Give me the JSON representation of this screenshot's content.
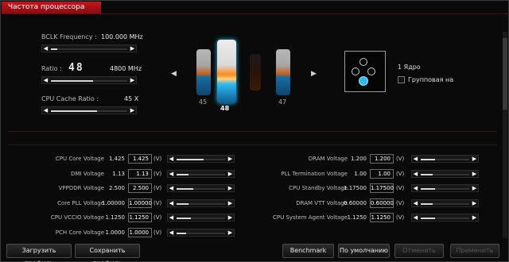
{
  "tab": {
    "title": "Частота процессора"
  },
  "bclk": {
    "label": "BCLK Frequency :",
    "value": "100.000 MHz",
    "slider_fraction": 0.08
  },
  "ratio": {
    "label": "Ratio :",
    "big_value": "48",
    "mhz": "4800 MHz",
    "slider_fraction": 0.55
  },
  "cache": {
    "label": "CPU Cache Ratio :",
    "value": "45 X",
    "slider_fraction": 0.6
  },
  "cores": {
    "labels": [
      "45",
      "48",
      "",
      "47"
    ],
    "active_index": 1
  },
  "core_panel": {
    "core_label": "1 Ядро",
    "group_label": "Групповая на"
  },
  "voltages_left": [
    {
      "label": "CPU Core Voltage",
      "value": "1.425",
      "box": "1.425",
      "unit": "(V)",
      "slider_fraction": 0.55
    },
    {
      "label": "DMI Voltage",
      "value": "1.13",
      "box": "1.13",
      "unit": "(V)",
      "slider_fraction": 0.25
    },
    {
      "label": "VPPDDR Voltage",
      "value": "2.500",
      "box": "2.500",
      "unit": "(V)",
      "slider_fraction": 0.35
    },
    {
      "label": "Core PLL Voltage",
      "value": "1.00000",
      "box": "1.00000",
      "unit": "(V)",
      "slider_fraction": 0.25
    },
    {
      "label": "CPU VCCIO Voltage",
      "value": "1.1250",
      "box": "1.1250",
      "unit": "(V)",
      "slider_fraction": 0.3
    },
    {
      "label": "PCH Core Voltage",
      "value": "1.0000",
      "box": "1.0000",
      "unit": "(V)",
      "slider_fraction": 0.2
    }
  ],
  "voltages_right": [
    {
      "label": "DRAM Voltage",
      "value": "1.200",
      "box": "1.200",
      "unit": "(V)",
      "slider_fraction": 0.3
    },
    {
      "label": "PLL Termination Voltage",
      "value": "1.00",
      "box": "1.00",
      "unit": "(V)",
      "slider_fraction": 0.25
    },
    {
      "label": "CPU Standby Voltage",
      "value": "1.17500",
      "box": "1.17500",
      "unit": "(V)",
      "slider_fraction": 0.3
    },
    {
      "label": "DRAM VTT Voltage",
      "value": "0.60000",
      "box": "0.60000",
      "unit": "(V)",
      "slider_fraction": 0.25
    },
    {
      "label": "CPU System Agent Voltage",
      "value": "1.1250",
      "box": "1.1250",
      "unit": "(V)",
      "slider_fraction": 0.3
    }
  ],
  "buttons": {
    "load_profile": "Загрузить профиль",
    "save_profile": "Сохранить профиль",
    "benchmark": "Benchmark",
    "default": "По умолчанию",
    "apply": "Отменить",
    "cancel": "Применить"
  },
  "colors": {
    "accent_red": "#c3141c",
    "orange": "#ff8a1a",
    "cyan": "#2fb8f0"
  }
}
